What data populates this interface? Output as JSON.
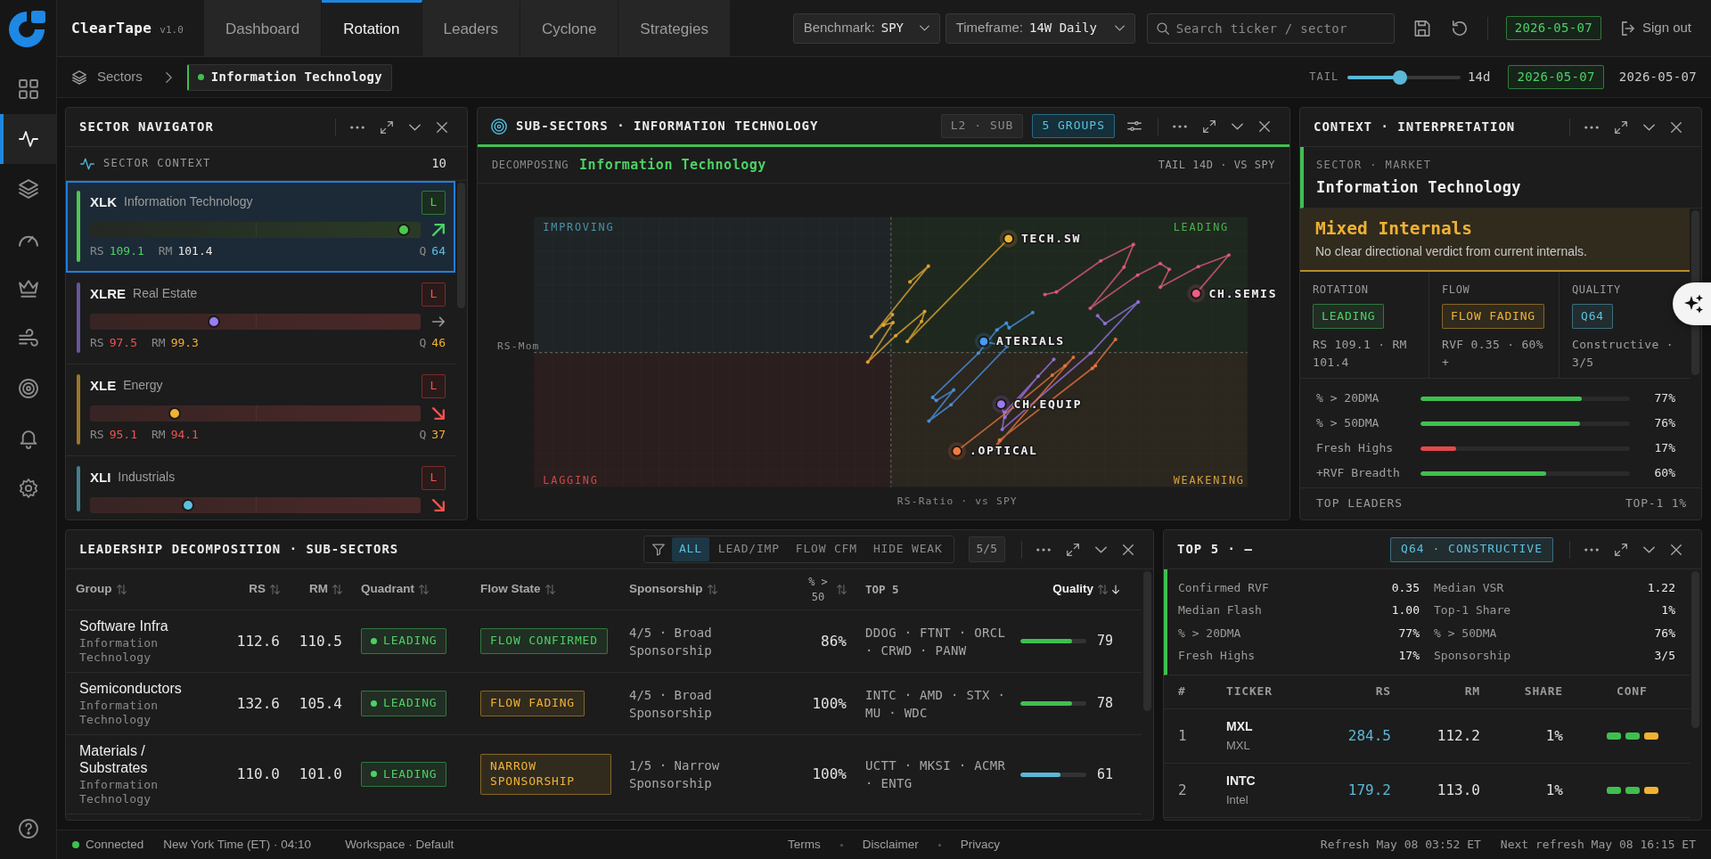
{
  "app": {
    "name": "ClearTape",
    "version": "v1.0"
  },
  "tabs": [
    {
      "label": "Dashboard",
      "selected": false
    },
    {
      "label": "Rotation",
      "selected": true
    },
    {
      "label": "Leaders",
      "selected": false
    },
    {
      "label": "Cyclone",
      "selected": false
    },
    {
      "label": "Strategies",
      "selected": false
    }
  ],
  "toolbar": {
    "benchmark": {
      "label": "Benchmark:",
      "value": "SPY"
    },
    "timeframe": {
      "label": "Timeframe:",
      "value": "14W Daily"
    },
    "search": {
      "placeholder": "Search ticker / sector"
    },
    "date": "2026-05-07",
    "sign_out": "Sign out"
  },
  "sidebar": {
    "items": [
      {
        "selected": false
      },
      {
        "selected": true
      },
      {
        "selected": false
      },
      {
        "selected": false
      },
      {
        "selected": false
      },
      {
        "selected": false
      },
      {
        "selected": false
      },
      {
        "selected": false
      },
      {
        "selected": false
      }
    ]
  },
  "breadcrumb": {
    "root": "Sectors",
    "current": "Information Technology"
  },
  "tail": {
    "label": "TAIL",
    "level": 0.46,
    "reading": "14d"
  },
  "as_of": {
    "badge": "2026-05-07",
    "date": "2026-05-07"
  },
  "sector_navigator": {
    "title": "SECTOR NAVIGATOR",
    "section": "SECTOR CONTEXT",
    "count": "10",
    "sectors": [
      {
        "ticker": "XLK",
        "name": "Information Technology",
        "badge": "L",
        "leading": true,
        "trend": {
          "kind": "up"
        },
        "selected": true,
        "color": "#4cc94c",
        "level": 0.95,
        "stats": [
          {
            "label": "RS",
            "value": "109.1",
            "color": "#4cd064"
          },
          {
            "label": "RM",
            "value": "101.4",
            "color": "#e6e6e6"
          },
          {
            "label": "Q",
            "value": "64",
            "color": "#5bc0de"
          }
        ]
      },
      {
        "ticker": "XLRE",
        "name": "Real Estate",
        "badge": "L",
        "leading": false,
        "trend": {
          "kind": "flat"
        },
        "selected": false,
        "color": "#9a7cf0",
        "level": 0.375,
        "stats": [
          {
            "label": "RS",
            "value": "97.5",
            "color": "#ef5350"
          },
          {
            "label": "RM",
            "value": "99.3",
            "color": "#f0b232"
          },
          {
            "label": "Q",
            "value": "46",
            "color": "#f0b232"
          }
        ]
      },
      {
        "ticker": "XLE",
        "name": "Energy",
        "badge": "L",
        "leading": false,
        "trend": {
          "kind": "down"
        },
        "selected": false,
        "color": "#f0b232",
        "level": 0.256,
        "stats": [
          {
            "label": "RS",
            "value": "95.1",
            "color": "#ef5350"
          },
          {
            "label": "RM",
            "value": "94.1",
            "color": "#ef5350"
          },
          {
            "label": "Q",
            "value": "37",
            "color": "#f0b232"
          }
        ]
      },
      {
        "ticker": "XLI",
        "name": "Industrials",
        "badge": "L",
        "leading": false,
        "trend": {
          "kind": "down"
        },
        "selected": false,
        "color": "#5bc0de",
        "level": 0.297
      }
    ]
  },
  "sub_sectors": {
    "title": "SUB-SECTORS · INFORMATION TECHNOLOGY",
    "chips": [
      {
        "label": "L2 · SUB",
        "selected": false
      },
      {
        "label": "5 GROUPS",
        "selected": true
      }
    ],
    "decomposing": {
      "label": "DECOMPOSING",
      "value": "Information Technology"
    },
    "tail_note": "TAIL 14D · VS SPY",
    "chart": {
      "quadrants": [
        {
          "label": "IMPROVING",
          "color": "#4a90a8"
        },
        {
          "label": "LEADING",
          "color": "#4caf50"
        },
        {
          "label": "LAGGING",
          "color": "#d04848"
        },
        {
          "label": "WEAKENING",
          "color": "#d4a040"
        }
      ],
      "y_label": "RS-Mom",
      "x_label": "RS-Ratio · vs SPY",
      "series": [
        {
          "label": "TECH.SW",
          "color": "#f0b232"
        },
        {
          "label": "CH.SEMIS",
          "color": "#ec5f80"
        },
        {
          "label": "ATERIALS",
          "color": "#4a9af0"
        },
        {
          "label": "CH.EQUIP",
          "color": "#a078f0"
        },
        {
          "label": ".OPTICAL",
          "color": "#f07a40"
        }
      ]
    }
  },
  "context": {
    "title": "CONTEXT · INTERPRETATION",
    "scope": "SECTOR · MARKET",
    "sector": "Information Technology",
    "verdict": {
      "title": "Mixed Internals",
      "text": "No clear directional verdict from current internals.",
      "color": "#f0b232"
    },
    "facets": [
      {
        "label": "ROTATION",
        "badge": "LEADING",
        "color": "#4cd064",
        "detail": "RS 109.1 · RM 101.4"
      },
      {
        "label": "FLOW",
        "badge": "FLOW FADING",
        "color": "#f0b232",
        "detail": "RVF 0.35 · 60% +"
      },
      {
        "label": "QUALITY",
        "badge": "Q64",
        "color": "#5bc0de",
        "detail": "Constructive · 3/5"
      }
    ],
    "breadth": [
      {
        "label": "% > 20DMA",
        "level": 0.77,
        "reading": "77%",
        "color": "#3fbf4f"
      },
      {
        "label": "% > 50DMA",
        "level": 0.76,
        "reading": "76%",
        "color": "#3fbf4f"
      },
      {
        "label": "Fresh Highs",
        "level": 0.17,
        "reading": "17%",
        "color": "#e5484d"
      },
      {
        "label": "+RVF Breadth",
        "level": 0.6,
        "reading": "60%",
        "color": "#3fbf4f"
      }
    ],
    "footer": {
      "label": "TOP LEADERS",
      "value": "TOP-1 1%"
    }
  },
  "leadership": {
    "title": "LEADERSHIP DECOMPOSITION · SUB-SECTORS",
    "filters": [
      {
        "label": "ALL",
        "selected": true
      },
      {
        "label": "LEAD/IMP",
        "selected": false
      },
      {
        "label": "FLOW CFM",
        "selected": false
      },
      {
        "label": "HIDE WEAK",
        "selected": false
      }
    ],
    "count": "5/5",
    "columns": [
      {
        "label": "Group",
        "sortable": true,
        "sorted": false
      },
      {
        "label": "RS",
        "sortable": true,
        "sorted": false
      },
      {
        "label": "RM",
        "sortable": true,
        "sorted": false
      },
      {
        "label": "Quadrant",
        "sortable": true,
        "sorted": false
      },
      {
        "label": "Flow State",
        "sortable": true,
        "sorted": false
      },
      {
        "label": "Sponsorship",
        "sortable": true,
        "sorted": false
      },
      {
        "label": "% > 50",
        "sortable": true,
        "sorted": false
      },
      {
        "label": "TOP 5",
        "sortable": false,
        "sorted": false
      },
      {
        "label": "Quality",
        "sortable": true,
        "sorted": true
      }
    ],
    "rows": [
      {
        "group": "Software Infra",
        "parent": "Information Technology",
        "rs": "112.6",
        "rm": "110.5",
        "quadrant": {
          "label": "LEADING",
          "color": "#4cd064"
        },
        "flow": {
          "label": "FLOW CONFIRMED",
          "color": "#4cd064"
        },
        "sponsorship": "4/5 · Broad Sponsorship",
        "pct_above_50": "86%",
        "top5": "DDOG · FTNT · ORCL · CRWD · PANW",
        "quality": {
          "level": 0.79,
          "reading": "79",
          "color": "#3fbf4f"
        }
      },
      {
        "group": "Semiconductors",
        "parent": "Information Technology",
        "rs": "132.6",
        "rm": "105.4",
        "quadrant": {
          "label": "LEADING",
          "color": "#4cd064"
        },
        "flow": {
          "label": "FLOW FADING",
          "color": "#f0b232"
        },
        "sponsorship": "4/5 · Broad Sponsorship",
        "pct_above_50": "100%",
        "top5": "INTC · AMD · STX · MU · WDC",
        "quality": {
          "level": 0.78,
          "reading": "78",
          "color": "#3fbf4f"
        }
      },
      {
        "group": "Materials / Substrates",
        "parent": "Information Technology",
        "rs": "110.0",
        "rm": "101.0",
        "quadrant": {
          "label": "LEADING",
          "color": "#4cd064"
        },
        "flow": {
          "label": "NARROW SPONSORSHIP",
          "color": "#f0b232"
        },
        "sponsorship": "1/5 · Narrow Sponsorship",
        "pct_above_50": "100%",
        "top5": "UCTT · MKSI · ACMR · ENTG",
        "quality": {
          "level": 0.61,
          "reading": "61",
          "color": "#5bb8d6"
        }
      }
    ]
  },
  "top5": {
    "title": "TOP 5 · —",
    "badge": {
      "label": "Q64 · CONSTRUCTIVE",
      "color": "#5bc0de"
    },
    "stats": [
      {
        "label": "Confirmed RVF",
        "value": "0.35"
      },
      {
        "label": "Median VSR",
        "value": "1.22"
      },
      {
        "label": "Median Flash",
        "value": "1.00"
      },
      {
        "label": "Top-1 Share",
        "value": "1%"
      },
      {
        "label": "% > 20DMA",
        "value": "77%"
      },
      {
        "label": "% > 50DMA",
        "value": "76%"
      },
      {
        "label": "Fresh Highs",
        "value": "17%"
      },
      {
        "label": "Sponsorship",
        "value": "3/5"
      }
    ],
    "columns": [
      "#",
      "TICKER",
      "RS",
      "RM",
      "SHARE",
      "CONF"
    ],
    "rows": [
      {
        "rank": "1",
        "ticker": "MXL",
        "name": "MXL",
        "rs": "284.5",
        "rm": "112.2",
        "share": "1%",
        "conf": [
          {
            "color": "#3fbf4f"
          },
          {
            "color": "#3fbf4f"
          },
          {
            "color": "#f0b232"
          }
        ]
      },
      {
        "rank": "2",
        "ticker": "INTC",
        "name": "Intel",
        "rs": "179.2",
        "rm": "113.0",
        "share": "1%",
        "conf": [
          {
            "color": "#3fbf4f"
          },
          {
            "color": "#3fbf4f"
          },
          {
            "color": "#f0b232"
          }
        ]
      }
    ]
  },
  "status_bar": {
    "connection": {
      "label": "Connected",
      "on": true
    },
    "clock": "New York Time (ET) · 04:10",
    "workspace": "Workspace · Default",
    "links": [
      "Terms",
      "Disclaimer",
      "Privacy"
    ],
    "refresh": "Refresh May 08 03:52 ET",
    "next_refresh": "Next refresh May 08 16:15 ET"
  }
}
